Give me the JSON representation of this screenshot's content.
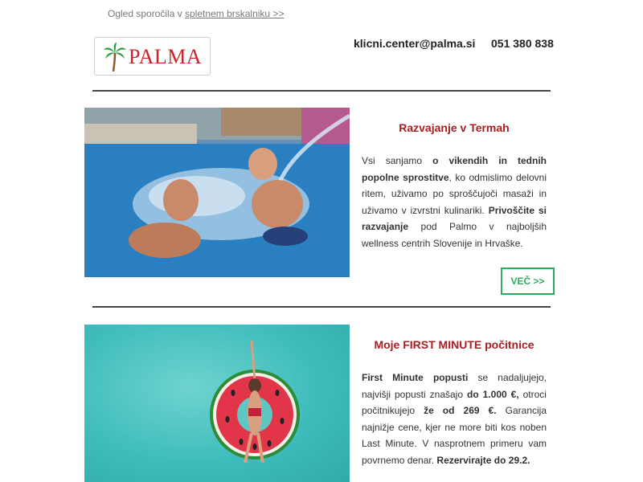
{
  "preheader": {
    "prefix": "Ogled sporočila v ",
    "link": "spletnem brskalniku >>"
  },
  "logo": {
    "text": "PALMA"
  },
  "contact": {
    "email": "klicni.center@palma.si",
    "phone": "051 380 838"
  },
  "articles": [
    {
      "title": "Razvajanje v Termah",
      "image_alt": "pool-splash-photo",
      "body": [
        {
          "text": "Vsi sanjamo ",
          "bold": false
        },
        {
          "text": "o vikendih in tednih popolne sprostitve",
          "bold": true
        },
        {
          "text": ", ko odmislimo delovni ritem, uživamo po sproščujoči masaži in uživamo v izvrstni kulinariki. ",
          "bold": false
        },
        {
          "text": "Privoščite si razvajanje",
          "bold": true
        },
        {
          "text": " pod Palmo v najboljših wellness centrih Slovenije in Hrvaške.",
          "bold": false
        }
      ],
      "button": "VEČ >>"
    },
    {
      "title": "Moje FIRST MINUTE počitnice",
      "image_alt": "watermelon-float-photo",
      "body": [
        {
          "text": "First Minute popusti",
          "bold": true
        },
        {
          "text": " se nadaljujejo, najvišji popusti znašajo ",
          "bold": false
        },
        {
          "text": "do 1.000 €,",
          "bold": true
        },
        {
          "text": " otroci počitnikujejo ",
          "bold": false
        },
        {
          "text": "že od 269 €.",
          "bold": true
        },
        {
          "text": " Garancija najnižje cene, kjer ne more biti kos noben Last Minute. V nasprotnem primeru vam povrnemo denar. ",
          "bold": false
        },
        {
          "text": "Rezervirajte do 29.2.",
          "bold": true
        }
      ]
    }
  ],
  "colors": {
    "title": "#a61e22",
    "button": "#2faa5f",
    "logo": "#c9242b",
    "palm": "#2e9b3f"
  }
}
